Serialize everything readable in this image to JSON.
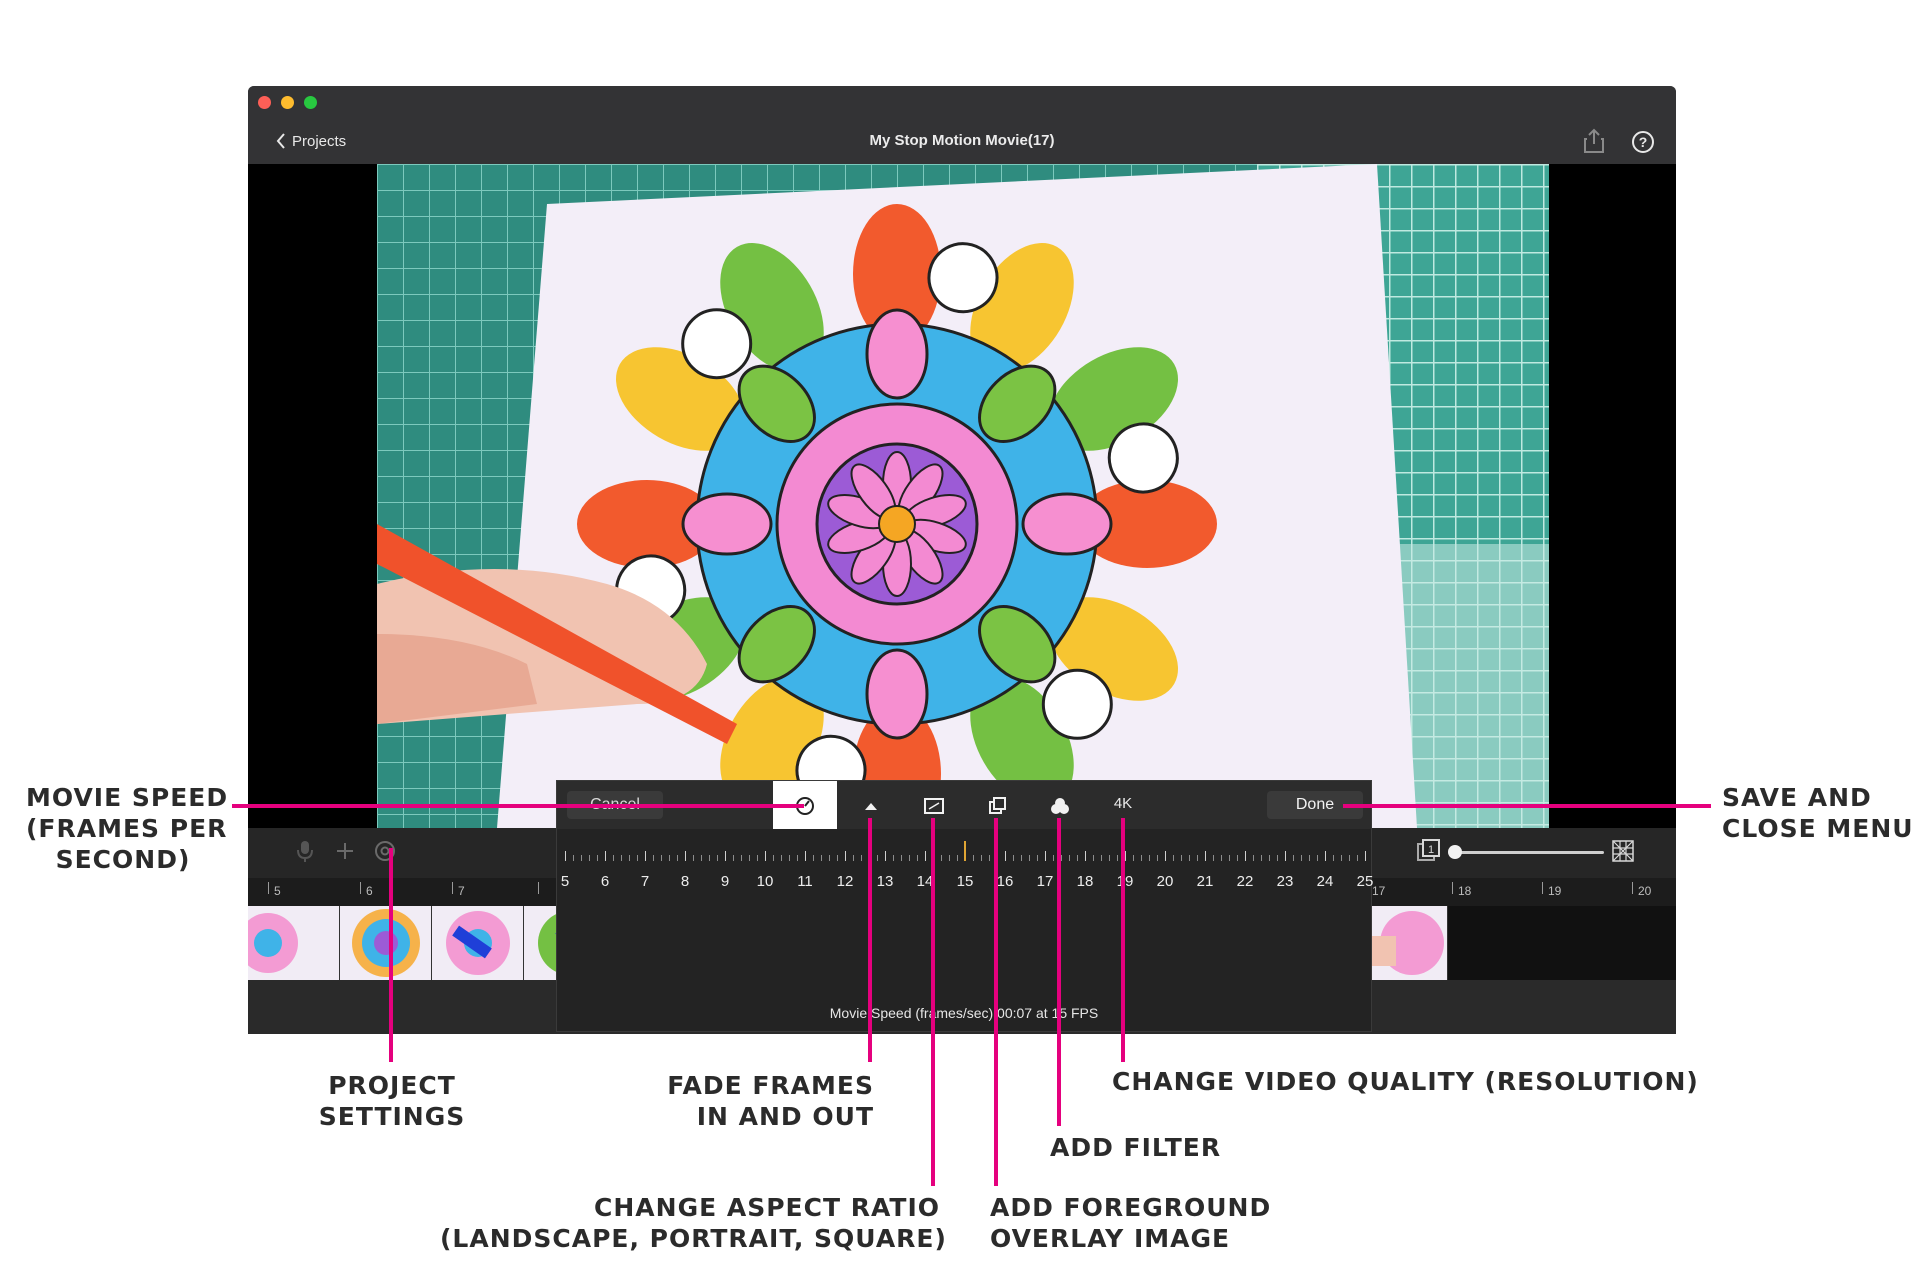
{
  "window": {
    "back_label": "Projects",
    "title": "My Stop Motion Movie(17)"
  },
  "timeline": {
    "ruler_labels": [
      "5",
      "6",
      "7",
      "17",
      "18",
      "19",
      "20"
    ]
  },
  "speed_panel": {
    "cancel_label": "Cancel",
    "done_label": "Done",
    "quality_label": "4K",
    "scale": [
      "5",
      "6",
      "7",
      "8",
      "9",
      "10",
      "11",
      "12",
      "13",
      "14",
      "15",
      "16",
      "17",
      "18",
      "19",
      "20",
      "21",
      "22",
      "23",
      "24",
      "25"
    ],
    "selected_fps": 15,
    "status": "Movie Speed (frames/sec) 00:07 at 15 FPS"
  },
  "annotations": {
    "movie_speed": [
      "MOVIE SPEED",
      "(FRAMES PER",
      "SECOND)"
    ],
    "save_close": [
      "SAVE AND",
      "CLOSE MENU"
    ],
    "project_settings": [
      "PROJECT",
      "SETTINGS"
    ],
    "fade_frames": [
      "FADE FRAMES",
      "IN AND OUT"
    ],
    "change_quality": "CHANGE VIDEO QUALITY (RESOLUTION)",
    "add_filter": "ADD FILTER",
    "aspect_ratio": [
      "CHANGE ASPECT RATIO",
      "(LANDSCAPE, PORTRAIT, SQUARE)"
    ],
    "foreground_overlay": [
      "ADD FOREGROUND",
      "OVERLAY IMAGE"
    ]
  },
  "colors": {
    "annotation_line": "#e5007e",
    "window_bg": "#252525",
    "titlebar": "#333335"
  },
  "icons": {
    "back": "chevron-left-icon",
    "share": "share-icon",
    "help": "help-icon",
    "microphone": "microphone-icon",
    "add": "plus-icon",
    "settings": "gear-icon",
    "speed": "speedometer-icon",
    "fade": "triangle-up-icon",
    "aspect": "aspect-ratio-icon",
    "overlay": "overlay-icon",
    "filter": "filter-icon",
    "onion_skin": "onion-skin-icon",
    "grid": "grid-icon"
  }
}
